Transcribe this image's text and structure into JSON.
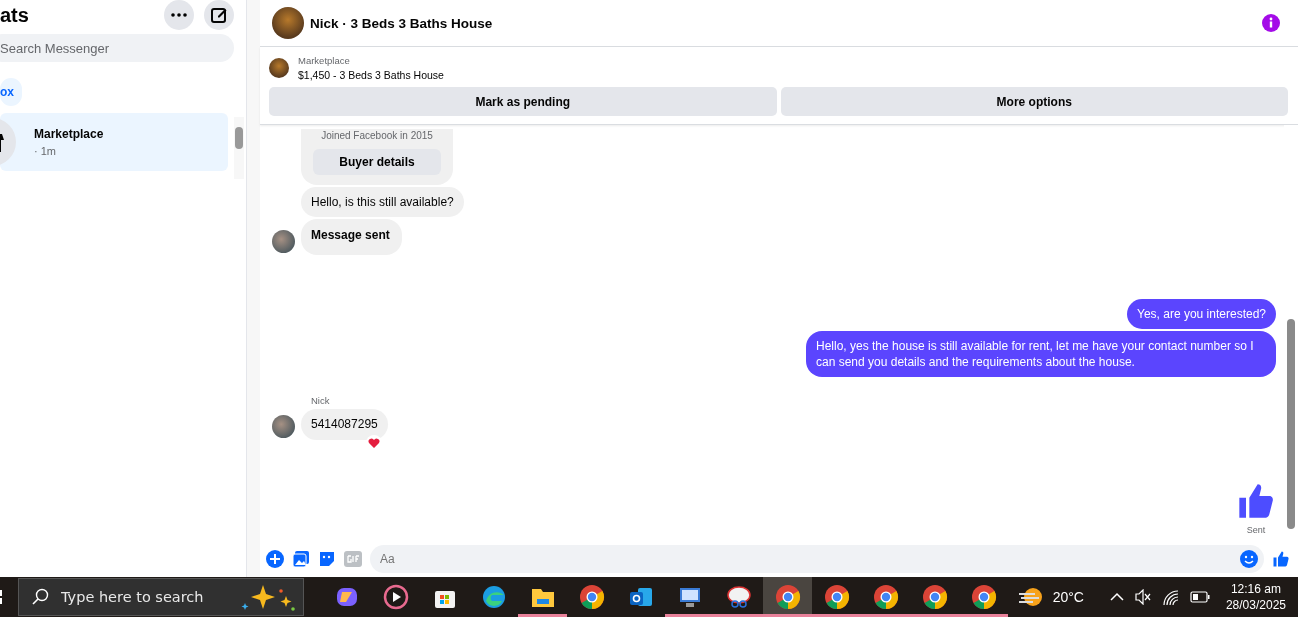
{
  "sidebar": {
    "title": "ats",
    "search": {
      "placeholder": "Search Messenger"
    },
    "filters": [
      {
        "label": "ox",
        "selected": true
      }
    ],
    "chats": [
      {
        "name": "Marketplace",
        "time": "· 1m",
        "selected": true
      }
    ]
  },
  "conversation": {
    "title": "Nick · 3 Beds 3 Baths House",
    "listing": {
      "source": "Marketplace",
      "summary": "$1,450 - 3 Beds 3 Baths House"
    },
    "actions": [
      "Mark as pending",
      "More options"
    ],
    "groups": [
      {
        "kind": "incoming",
        "messages": [
          {
            "kind": "card",
            "note": "Joined Facebook in 2015",
            "button": "Buyer details"
          },
          {
            "kind": "text",
            "text": "Hello, is this still available?"
          },
          {
            "kind": "bold",
            "text": "Message sent"
          }
        ]
      },
      {
        "kind": "outgoing",
        "messages": [
          {
            "kind": "text",
            "text": "Yes, are you interested?"
          },
          {
            "kind": "text",
            "text": "Hello, yes the house is still available for rent, let me have your contact number so I can send you details and the requirements about the house."
          }
        ]
      },
      {
        "kind": "incoming",
        "sender": "Nick",
        "messages": [
          {
            "kind": "text",
            "text": "5414087295",
            "reaction": true
          }
        ]
      }
    ],
    "status": "Sent",
    "composer": {
      "placeholder": "Aa"
    }
  },
  "taskbar": {
    "search": {
      "placeholder": "Type here to search"
    },
    "apps": [
      {
        "kind": "copilot",
        "running": false,
        "selected": false
      },
      {
        "kind": "player",
        "running": false,
        "selected": false
      },
      {
        "kind": "store",
        "running": false,
        "selected": false
      },
      {
        "kind": "edge",
        "running": false,
        "selected": false
      },
      {
        "kind": "folder",
        "running": true,
        "selected": false
      },
      {
        "kind": "chrome",
        "running": false,
        "selected": false
      },
      {
        "kind": "outlook",
        "running": false,
        "selected": false
      },
      {
        "kind": "monitor",
        "running": true,
        "selected": false
      },
      {
        "kind": "scissors",
        "running": true,
        "selected": false
      },
      {
        "kind": "chrome",
        "running": true,
        "selected": true
      },
      {
        "kind": "chrome",
        "running": true,
        "selected": false
      },
      {
        "kind": "chrome",
        "running": true,
        "selected": false
      },
      {
        "kind": "chrome",
        "running": true,
        "selected": false
      },
      {
        "kind": "chrome",
        "running": true,
        "selected": false
      }
    ],
    "weather": "20°C",
    "time": "12:16 am",
    "date": "28/03/2025"
  }
}
